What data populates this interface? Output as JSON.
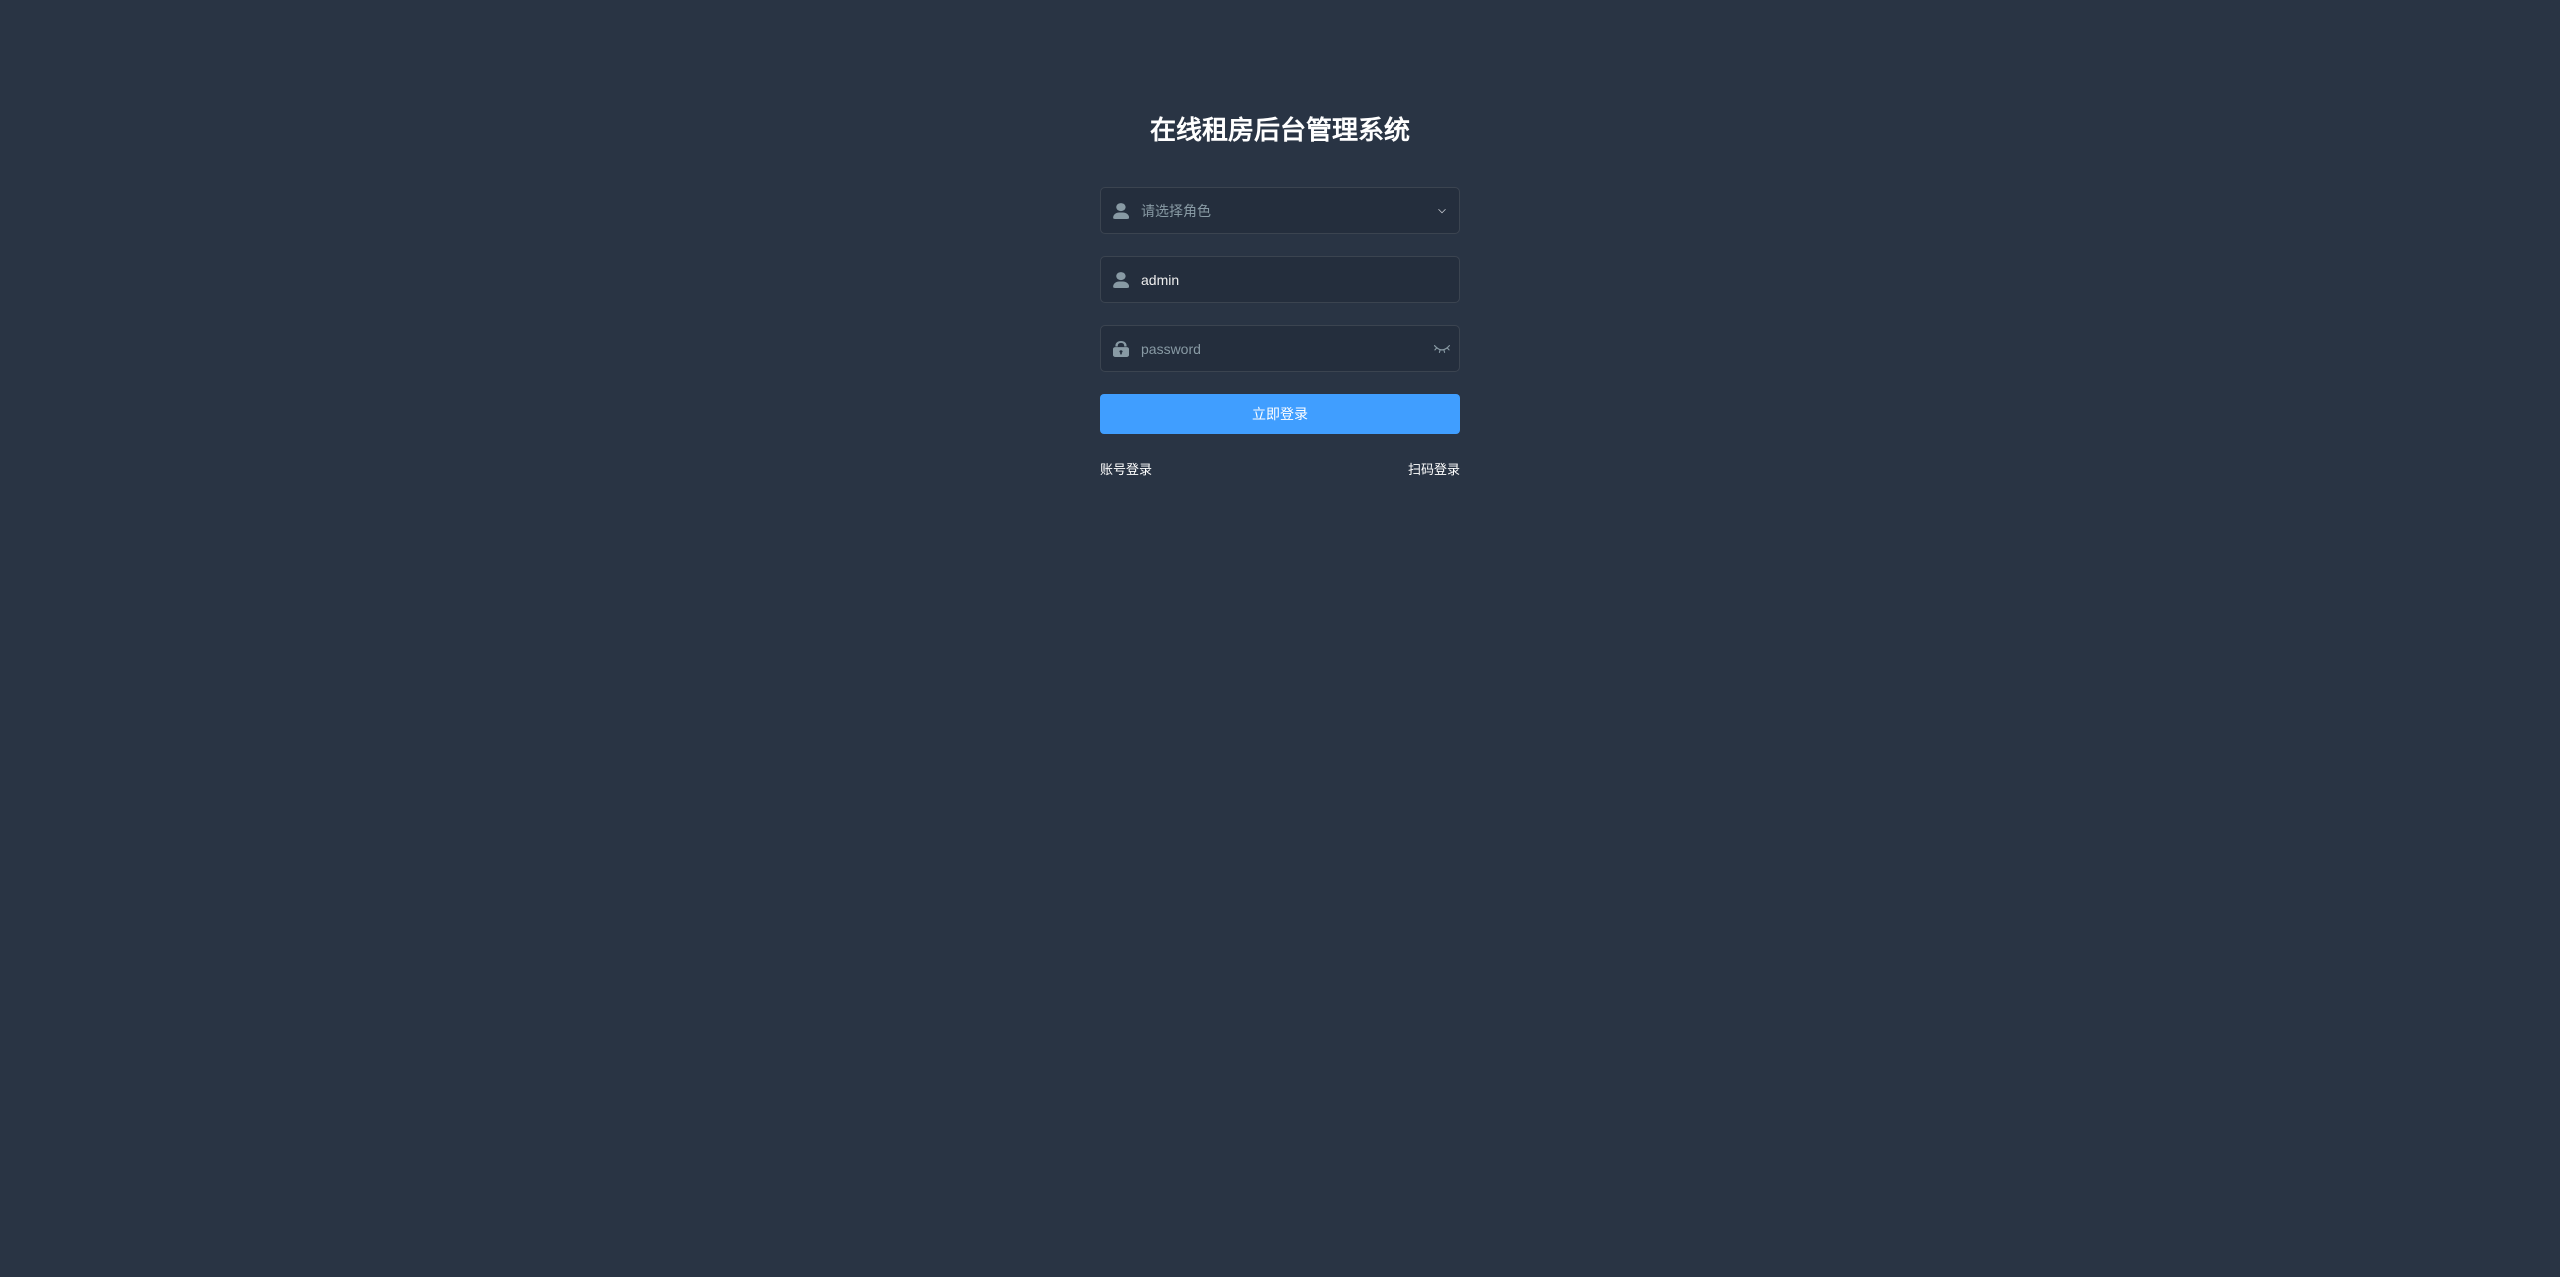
{
  "title": "在线租房后台管理系统",
  "roleSelect": {
    "placeholder": "请选择角色"
  },
  "usernameField": {
    "value": "admin"
  },
  "passwordField": {
    "placeholder": "password"
  },
  "loginButton": {
    "label": "立即登录"
  },
  "bottomLinks": {
    "accountLogin": "账号登录",
    "qrLogin": "扫码登录"
  }
}
